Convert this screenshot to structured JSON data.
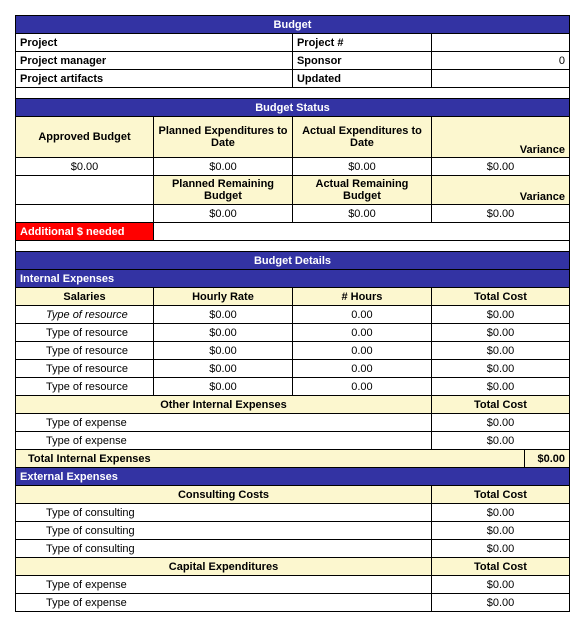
{
  "section1": {
    "title": "Budget",
    "project_label": "Project",
    "project_num_label": "Project #",
    "project_num_value": "",
    "pm_label": "Project manager",
    "sponsor_label": "Sponsor",
    "sponsor_value": "0",
    "artifacts_label": "Project artifacts",
    "updated_label": "Updated",
    "updated_value": ""
  },
  "status": {
    "title": "Budget Status",
    "approved_label": "Approved Budget",
    "planned_exp_label": "Planned Expenditures to Date",
    "actual_exp_label": "Actual Expenditures to Date",
    "variance_label": "Variance",
    "approved_value": "$0.00",
    "planned_exp_value": "$0.00",
    "actual_exp_value": "$0.00",
    "variance_value": "$0.00",
    "planned_rem_label": "Planned Remaining Budget",
    "actual_rem_label": "Actual Remaining Budget",
    "variance2_label": "Variance",
    "planned_rem_value": "$0.00",
    "actual_rem_value": "$0.00",
    "variance2_value": "$0.00",
    "additional_label": "Additional $ needed"
  },
  "details": {
    "title": "Budget Details",
    "internal_label": "Internal Expenses",
    "salaries_label": "Salaries",
    "hourly_label": "Hourly Rate",
    "hours_label": "# Hours",
    "total_cost_label": "Total Cost",
    "salary_rows": [
      {
        "name": "Type of resource",
        "rate": "$0.00",
        "hours": "0.00",
        "cost": "$0.00"
      },
      {
        "name": "Type of resource",
        "rate": "$0.00",
        "hours": "0.00",
        "cost": "$0.00"
      },
      {
        "name": "Type of resource",
        "rate": "$0.00",
        "hours": "0.00",
        "cost": "$0.00"
      },
      {
        "name": "Type of resource",
        "rate": "$0.00",
        "hours": "0.00",
        "cost": "$0.00"
      },
      {
        "name": "Type of resource",
        "rate": "$0.00",
        "hours": "0.00",
        "cost": "$0.00"
      }
    ],
    "other_internal_label": "Other Internal Expenses",
    "other_rows": [
      {
        "name": "Type of expense",
        "cost": "$0.00"
      },
      {
        "name": "Type of expense",
        "cost": "$0.00"
      }
    ],
    "total_internal_label": "Total Internal Expenses",
    "total_internal_value": "$0.00",
    "external_label": "External Expenses",
    "consulting_label": "Consulting Costs",
    "consulting_rows": [
      {
        "name": "Type of consulting",
        "cost": "$0.00"
      },
      {
        "name": "Type of consulting",
        "cost": "$0.00"
      },
      {
        "name": "Type of consulting",
        "cost": "$0.00"
      }
    ],
    "capital_label": "Capital Expenditures",
    "capital_rows": [
      {
        "name": "Type of expense",
        "cost": "$0.00"
      },
      {
        "name": "Type of expense",
        "cost": "$0.00"
      }
    ]
  }
}
